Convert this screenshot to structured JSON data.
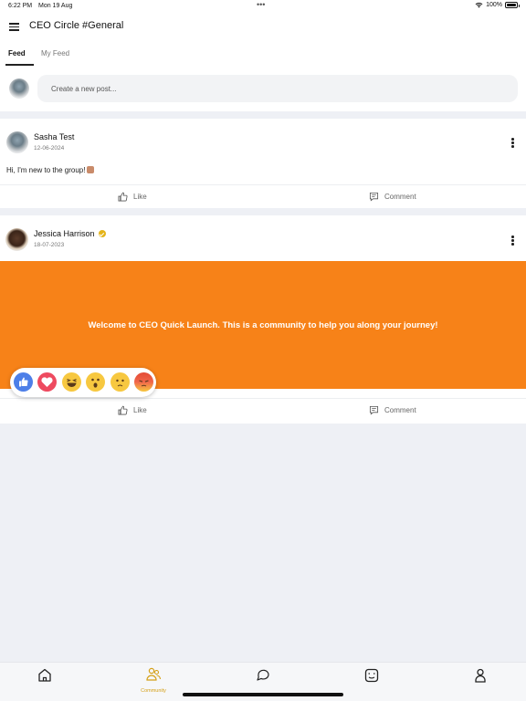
{
  "status_bar": {
    "time": "6:22 PM",
    "date": "Mon 19 Aug",
    "dots": "•••",
    "battery": "100%",
    "battery_level": 1.0
  },
  "header": {
    "title": "CEO Circle #General"
  },
  "tabs": [
    {
      "label": "Feed",
      "active": true
    },
    {
      "label": "My Feed",
      "active": false
    }
  ],
  "composer": {
    "placeholder": "Create a new post..."
  },
  "posts": [
    {
      "author": "Sasha Test",
      "date": "12-06-2024",
      "text": "Hi, I'm new to the group!",
      "verified": false
    },
    {
      "author": "Jessica Harrison",
      "date": "18-07-2023",
      "text": "Welcome to CEO Quick Launch. This is a community to help you along your journey!",
      "verified": true
    }
  ],
  "actions": {
    "like": "Like",
    "comment": "Comment"
  },
  "reactions": [
    "like",
    "love",
    "haha",
    "wow",
    "sad",
    "angry"
  ],
  "bottom_nav": [
    {
      "icon": "home-icon",
      "label": ""
    },
    {
      "icon": "community-icon",
      "label": "Community",
      "active": true
    },
    {
      "icon": "chat-icon",
      "label": ""
    },
    {
      "icon": "journal-icon",
      "label": ""
    },
    {
      "icon": "profile-icon",
      "label": ""
    }
  ],
  "colors": {
    "accent": "#d4a017",
    "banner": "#f78218",
    "like_blue": "#4d7fe8",
    "love_red": "#ee4a5f"
  }
}
